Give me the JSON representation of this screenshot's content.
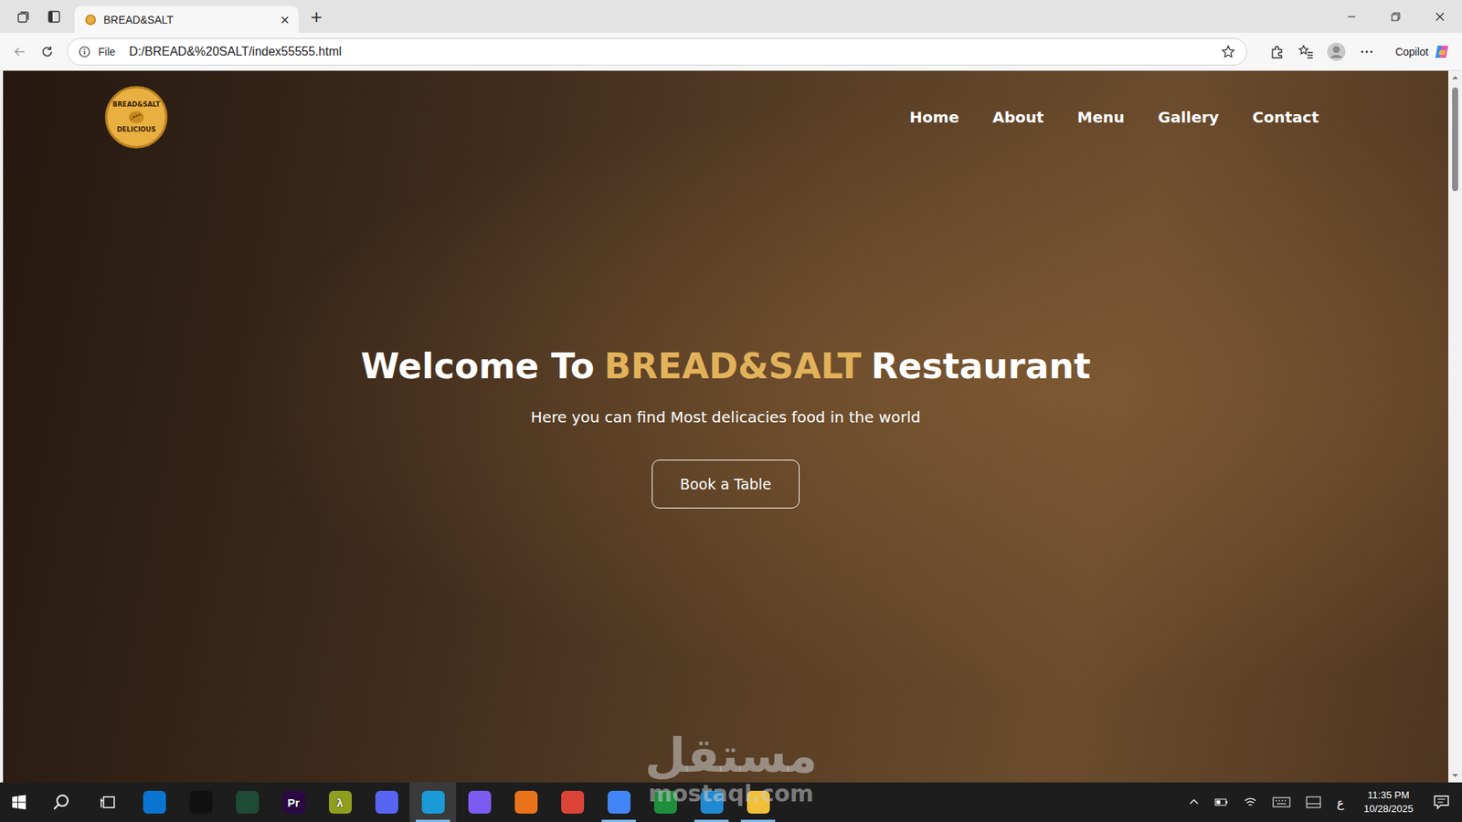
{
  "browser": {
    "tab_title": "BREAD&SALT",
    "tab_close": "×",
    "new_tab": "+",
    "tab_selected": true
  },
  "address_bar": {
    "scheme_label": "File",
    "url": "D:/BREAD&%20SALT/index55555.html",
    "copilot": "Copilot"
  },
  "page": {
    "logo": {
      "top": "BREAD&SALT",
      "bottom": "DELICIOUS"
    },
    "nav": [
      {
        "label": "Home"
      },
      {
        "label": "About"
      },
      {
        "label": "Menu"
      },
      {
        "label": "Gallery"
      },
      {
        "label": "Contact"
      }
    ],
    "hero": {
      "title_before": "Welcome To",
      "title_brand": "BREAD&SALT",
      "title_after": "Restaurant",
      "subtitle": "Here you can find Most delicacies food in the world",
      "button": "Book a Table"
    }
  },
  "watermark": {
    "arabic": "مستقل",
    "latin": "mostaql.com"
  },
  "taskbar": {
    "apps": [
      {
        "label": "",
        "color": "#0a74d0",
        "running": false,
        "selected": false
      },
      {
        "label": "",
        "color": "#111111",
        "running": false,
        "selected": false
      },
      {
        "label": "",
        "color": "#1f4a36",
        "running": false,
        "selected": false
      },
      {
        "label": "Pr",
        "color": "#2b0a44",
        "running": false,
        "selected": false
      },
      {
        "label": "λ",
        "color": "#8f9e1e",
        "running": false,
        "selected": false
      },
      {
        "label": "",
        "color": "#5865f2",
        "running": false,
        "selected": false
      },
      {
        "label": "",
        "color": "#1a9ad6",
        "running": true,
        "selected": true
      },
      {
        "label": "",
        "color": "#7b5cf0",
        "running": false,
        "selected": false
      },
      {
        "label": "",
        "color": "#e8731a",
        "running": false,
        "selected": false
      },
      {
        "label": "",
        "color": "#db4437",
        "running": false,
        "selected": false
      },
      {
        "label": "",
        "color": "#4285f4",
        "running": true,
        "selected": false
      },
      {
        "label": "",
        "color": "#1e8e3e",
        "running": false,
        "selected": false
      },
      {
        "label": "",
        "color": "#1f8ad2",
        "running": true,
        "selected": false
      },
      {
        "label": "",
        "color": "#f2c037",
        "running": true,
        "selected": false
      }
    ],
    "input_language": "ع",
    "clock": {
      "time": "11:35 PM",
      "date": "10/28/2025"
    }
  }
}
